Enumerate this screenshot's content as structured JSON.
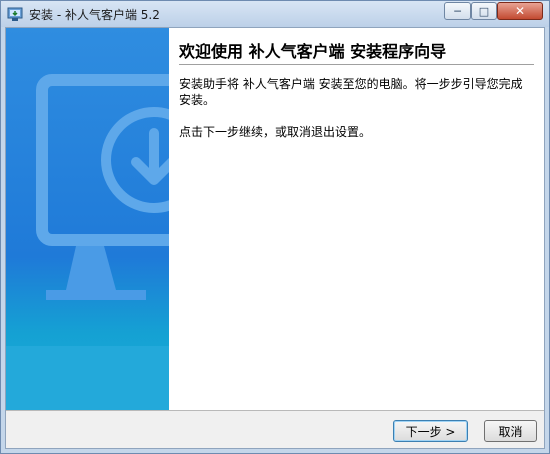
{
  "window": {
    "title": "安装 - 补人气客户端 5.2",
    "controls": {
      "minimize": "─",
      "maximize": "□",
      "close": "✕"
    }
  },
  "sidebar": {
    "icon": "monitor-download-icon"
  },
  "content": {
    "title": "欢迎使用 补人气客户端 安装程序向导",
    "paragraph1": "安装助手将 补人气客户端 安装至您的电脑。将一步步引导您完成安装。",
    "paragraph2": "点击下一步继续，或取消退出设置。"
  },
  "buttons": {
    "next": "下一步 >",
    "cancel": "取消"
  },
  "colors": {
    "sidebar": "#1f7ad8",
    "accent": "#23a9da"
  }
}
